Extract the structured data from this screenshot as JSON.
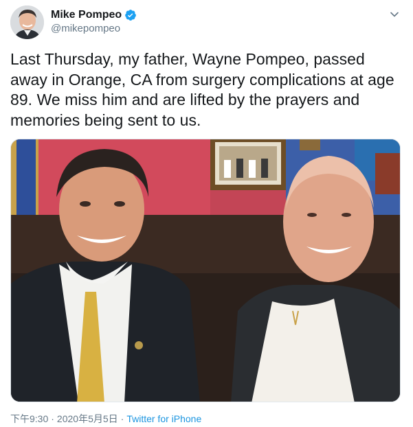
{
  "author": {
    "display_name": "Mike Pompeo",
    "handle": "@mikepompeo",
    "verified": true
  },
  "tweet": {
    "text": "Last Thursday, my father, Wayne Pompeo, passed away in Orange, CA from surgery complications at age 89. We miss him and are lifted by the prayers and memories being sent to us."
  },
  "meta": {
    "time": "下午9:30",
    "separator": "·",
    "date": "2020年5月5日",
    "separator2": "·",
    "source": "Twitter for iPhone"
  },
  "icons": {
    "verified": "verified-badge-icon",
    "menu": "chevron-down-icon"
  },
  "colors": {
    "text": "#14171a",
    "secondary": "#657786",
    "link": "#1b95e0",
    "verified": "#1da1f2"
  }
}
